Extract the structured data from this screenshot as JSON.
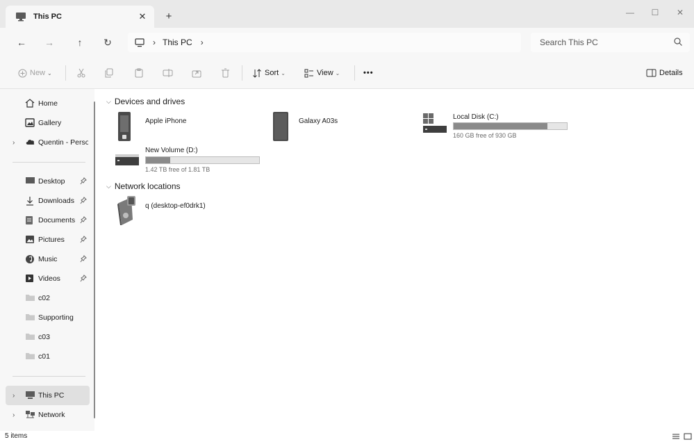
{
  "window": {
    "tab_title": "This PC",
    "tab_close": "✕",
    "new_tab": "+",
    "minimize": "—",
    "maximize": "☐",
    "close": "✕"
  },
  "nav": {
    "back": "←",
    "forward": "→",
    "up": "↑",
    "refresh": "↻",
    "breadcrumb_sep": "›",
    "breadcrumb": [
      "This PC"
    ],
    "breadcrumb_trailing_sep": "›",
    "search_placeholder": "Search This PC"
  },
  "toolbar": {
    "new_label": "New",
    "sort_label": "Sort",
    "view_label": "View",
    "more_label": "•••",
    "details_label": "Details"
  },
  "sidebar": {
    "top": [
      {
        "label": "Home",
        "icon": "home-icon",
        "chevron": ""
      },
      {
        "label": "Gallery",
        "icon": "gallery-icon",
        "chevron": ""
      },
      {
        "label": "Quentin - Perso",
        "icon": "cloud-icon",
        "chevron": "›"
      }
    ],
    "pinned": [
      {
        "label": "Desktop",
        "icon": "desktop-icon"
      },
      {
        "label": "Downloads",
        "icon": "download-icon"
      },
      {
        "label": "Documents",
        "icon": "documents-icon"
      },
      {
        "label": "Pictures",
        "icon": "pictures-icon"
      },
      {
        "label": "Music",
        "icon": "music-icon"
      },
      {
        "label": "Videos",
        "icon": "videos-icon"
      }
    ],
    "folders": [
      "c02",
      "Supporting",
      "c03",
      "c01"
    ],
    "bottom": [
      {
        "label": "This PC",
        "icon": "this-pc-icon",
        "chevron": "›",
        "selected": true
      },
      {
        "label": "Network",
        "icon": "network-icon",
        "chevron": "›",
        "selected": false
      }
    ]
  },
  "content": {
    "groups": {
      "devices": "Devices and drives",
      "network": "Network locations"
    },
    "devices": {
      "iphone": "Apple iPhone",
      "galaxy": "Galaxy A03s",
      "local_disk": {
        "name": "Local Disk (C:)",
        "free": "160 GB free of 930 GB",
        "used_fraction": 0.828
      },
      "new_volume": {
        "name": "New Volume (D:)",
        "free": "1.42 TB free of 1.81 TB",
        "used_fraction": 0.215
      }
    },
    "network": {
      "share": "q (desktop-ef0drk1)"
    }
  },
  "status": {
    "item_count": "5 items"
  },
  "colors": {
    "chrome": "#f7f7f7",
    "titlebar": "#e9e9e9",
    "selected": "#e0e0e0",
    "bar_fill": "#8a8a8a",
    "bar_track": "#e6e6e6"
  }
}
